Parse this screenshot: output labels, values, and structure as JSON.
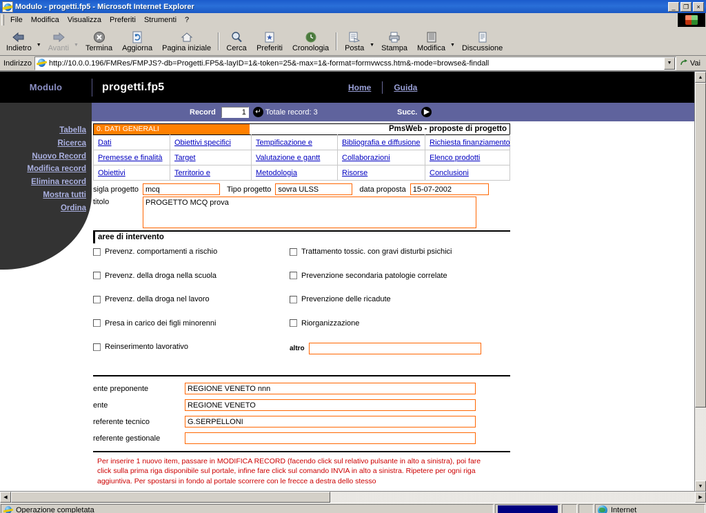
{
  "window": {
    "title": "Modulo - progetti.fp5 - Microsoft Internet Explorer",
    "icon": "ie-document-icon",
    "minimize": "_",
    "maximize": "❐",
    "close": "×"
  },
  "menubar": {
    "items": [
      {
        "label": "File",
        "accel": "F"
      },
      {
        "label": "Modifica",
        "accel": "M"
      },
      {
        "label": "Visualizza",
        "accel": "V"
      },
      {
        "label": "Preferiti",
        "accel": "P"
      },
      {
        "label": "Strumenti",
        "accel": "S"
      },
      {
        "label": "?",
        "accel": ""
      }
    ]
  },
  "toolbar": {
    "buttons": [
      {
        "label": "Indietro",
        "icon": "back-arrow-icon",
        "disabled": false,
        "caret": true
      },
      {
        "label": "Avanti",
        "icon": "forward-arrow-icon",
        "disabled": true,
        "caret": true
      },
      {
        "label": "Termina",
        "icon": "stop-icon",
        "disabled": false,
        "caret": false
      },
      {
        "label": "Aggiorna",
        "icon": "refresh-icon",
        "disabled": false,
        "caret": false
      },
      {
        "label": "Pagina iniziale",
        "icon": "home-icon",
        "disabled": false,
        "caret": false
      },
      {
        "label": "Cerca",
        "icon": "search-icon",
        "disabled": false,
        "caret": false
      },
      {
        "label": "Preferiti",
        "icon": "favorites-star-icon",
        "disabled": false,
        "caret": false
      },
      {
        "label": "Cronologia",
        "icon": "history-clock-icon",
        "disabled": false,
        "caret": false
      },
      {
        "label": "Posta",
        "icon": "mail-icon",
        "disabled": false,
        "caret": true
      },
      {
        "label": "Stampa",
        "icon": "print-icon",
        "disabled": false,
        "caret": false
      },
      {
        "label": "Modifica",
        "icon": "edit-page-icon",
        "disabled": false,
        "caret": true
      },
      {
        "label": "Discussione",
        "icon": "discussion-icon",
        "disabled": false,
        "caret": false
      }
    ]
  },
  "address": {
    "label": "Indirizzo",
    "value": "http://10.0.0.196/FMRes/FMPJS?-db=Progetti.FP5&-layID=1&-token=25&-max=1&-format=formvwcss.htm&-mode=browse&-findall",
    "placeholder": "",
    "go_label": "Vai"
  },
  "page": {
    "header": {
      "module_label": "Modulo",
      "title": "progetti.fp5",
      "links": [
        "Home",
        "Guida"
      ]
    },
    "sidebar": {
      "items": [
        "Tabella",
        "Ricerca",
        "Nuovo Record",
        "Modifica record",
        "Elimina record",
        "Mostra tutti",
        "Ordina"
      ]
    },
    "recordbar": {
      "record_label": "Record",
      "record_value": "1",
      "goto_icon": "enter-arrow-icon",
      "total_label": "Totale record: 3",
      "next_label": "Succ.",
      "next_icon": "play-right-icon"
    },
    "panel": {
      "tab_title_left": "0. DATI GENERALI",
      "tab_title_right": "PmsWeb - proposte di progetto",
      "tab_rows": [
        [
          "Dati",
          "Obiettivi specifici",
          "Tempificazione e",
          "Bibliografia e diffusione",
          "Richiesta finanziamento"
        ],
        [
          "Premesse e finalità",
          "Target",
          "Valutazione e gantt",
          "Collaborazioni",
          "Elenco prodotti"
        ],
        [
          "Obiettivi",
          "Territorio e",
          "Metodologia",
          "Risorse",
          "Conclusioni"
        ]
      ]
    },
    "fields": {
      "sigla_label": "sigla progetto",
      "sigla_value": "mcq",
      "tipo_label": "Tipo progetto",
      "tipo_value": "sovra ULSS",
      "data_label": "data proposta",
      "data_value": "15-07-2002",
      "titolo_label": "titolo",
      "titolo_value": "PROGETTO MCQ prova"
    },
    "aree": {
      "section_title": "aree di intervento",
      "left_checks": [
        "Prevenz. comportamenti a rischio",
        "Prevenz. della droga nella scuola",
        "Prevenz. della droga nel lavoro",
        "Presa in carico dei figli minorenni",
        "Reinserimento lavorativo"
      ],
      "right_checks": [
        "Trattamento tossic. con gravi disturbi psichici",
        "Prevenzione secondaria patologie correlate",
        "Prevenzione delle ricadute",
        "Riorganizzazione"
      ],
      "altro_label": "altro",
      "altro_value": ""
    },
    "ente": {
      "rows": [
        {
          "label": "ente preponente",
          "value": "REGIONE VENETO nnn"
        },
        {
          "label": "ente",
          "value": "REGIONE VENETO"
        },
        {
          "label": "referente tecnico",
          "value": "G.SERPELLONI"
        },
        {
          "label": "referente gestionale",
          "value": ""
        }
      ]
    },
    "warning": "Per inserire 1 nuovo item, passare in MODIFICA RECORD (facendo click sul relativo pulsante in alto a sinistra), poi fare click sulla prima riga disponibile sul portale, infine fare click sul comando INVIA in alto a sinistra. Ripetere per ogni riga aggiuntiva. Per spostarsi in fondo al portale scorrere con le frecce a destra dello stesso"
  },
  "statusbar": {
    "message": "Operazione completata",
    "zone": "Internet",
    "zone_icon": "globe-icon"
  },
  "colors": {
    "accent_orange": "#ff8000",
    "header_black": "#000000",
    "record_purple": "#5f639d",
    "sidebar_dark": "#333333",
    "link_blue": "#0000c0",
    "warning_red": "#cc0000",
    "titlebar_blue": "#1c5ccc"
  }
}
